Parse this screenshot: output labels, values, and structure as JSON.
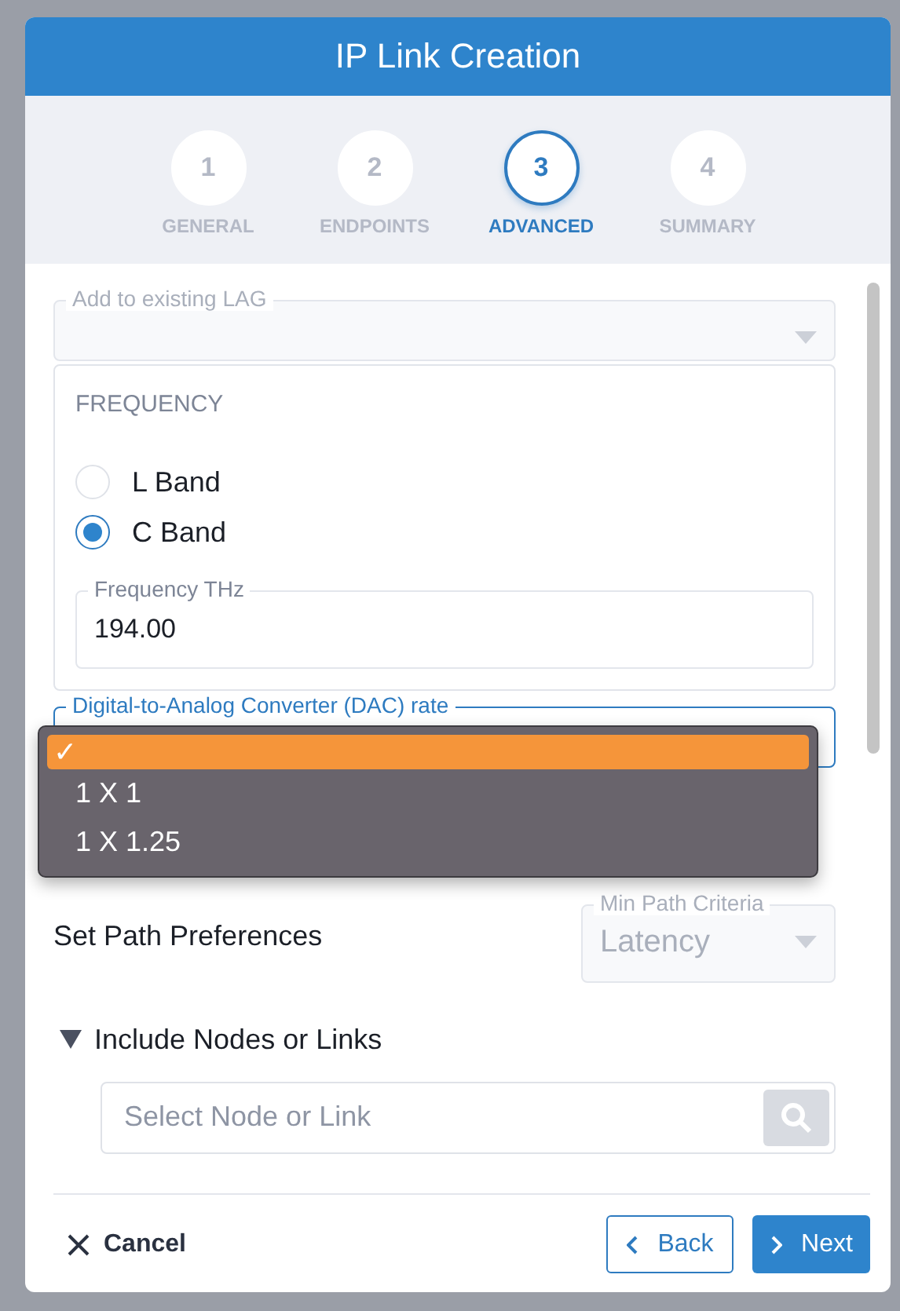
{
  "dialog": {
    "title": "IP Link Creation"
  },
  "steps": [
    {
      "number": "1",
      "label": "GENERAL",
      "selected": false
    },
    {
      "number": "2",
      "label": "ENDPOINTS",
      "selected": false
    },
    {
      "number": "3",
      "label": "ADVANCED",
      "selected": true
    },
    {
      "number": "4",
      "label": "SUMMARY",
      "selected": false
    }
  ],
  "lag_field": {
    "label": "Add to existing LAG",
    "disabled": true
  },
  "frequency": {
    "heading": "FREQUENCY",
    "options": [
      {
        "label": "L Band",
        "selected": false
      },
      {
        "label": "C Band",
        "selected": true
      }
    ],
    "field": {
      "label": "Frequency THz",
      "value": "194.00"
    }
  },
  "dac_field": {
    "label": "Digital-to-Analog Converter (DAC) rate",
    "dropdown": [
      {
        "mark": "✓",
        "selected": true
      },
      {
        "label": "1 X 1",
        "selected": false
      },
      {
        "label": "1 X 1.25",
        "selected": false
      }
    ]
  },
  "path": {
    "label": "Set Path Preferences",
    "criteria": {
      "label": "Min Path Criteria",
      "value": "Latency",
      "disabled": true
    }
  },
  "include": {
    "label": "Include Nodes or Links",
    "expanded": true,
    "search": {
      "placeholder": "Select Node or Link"
    }
  },
  "footer": {
    "cancel": "Cancel",
    "back": "Back",
    "next": "Next"
  }
}
